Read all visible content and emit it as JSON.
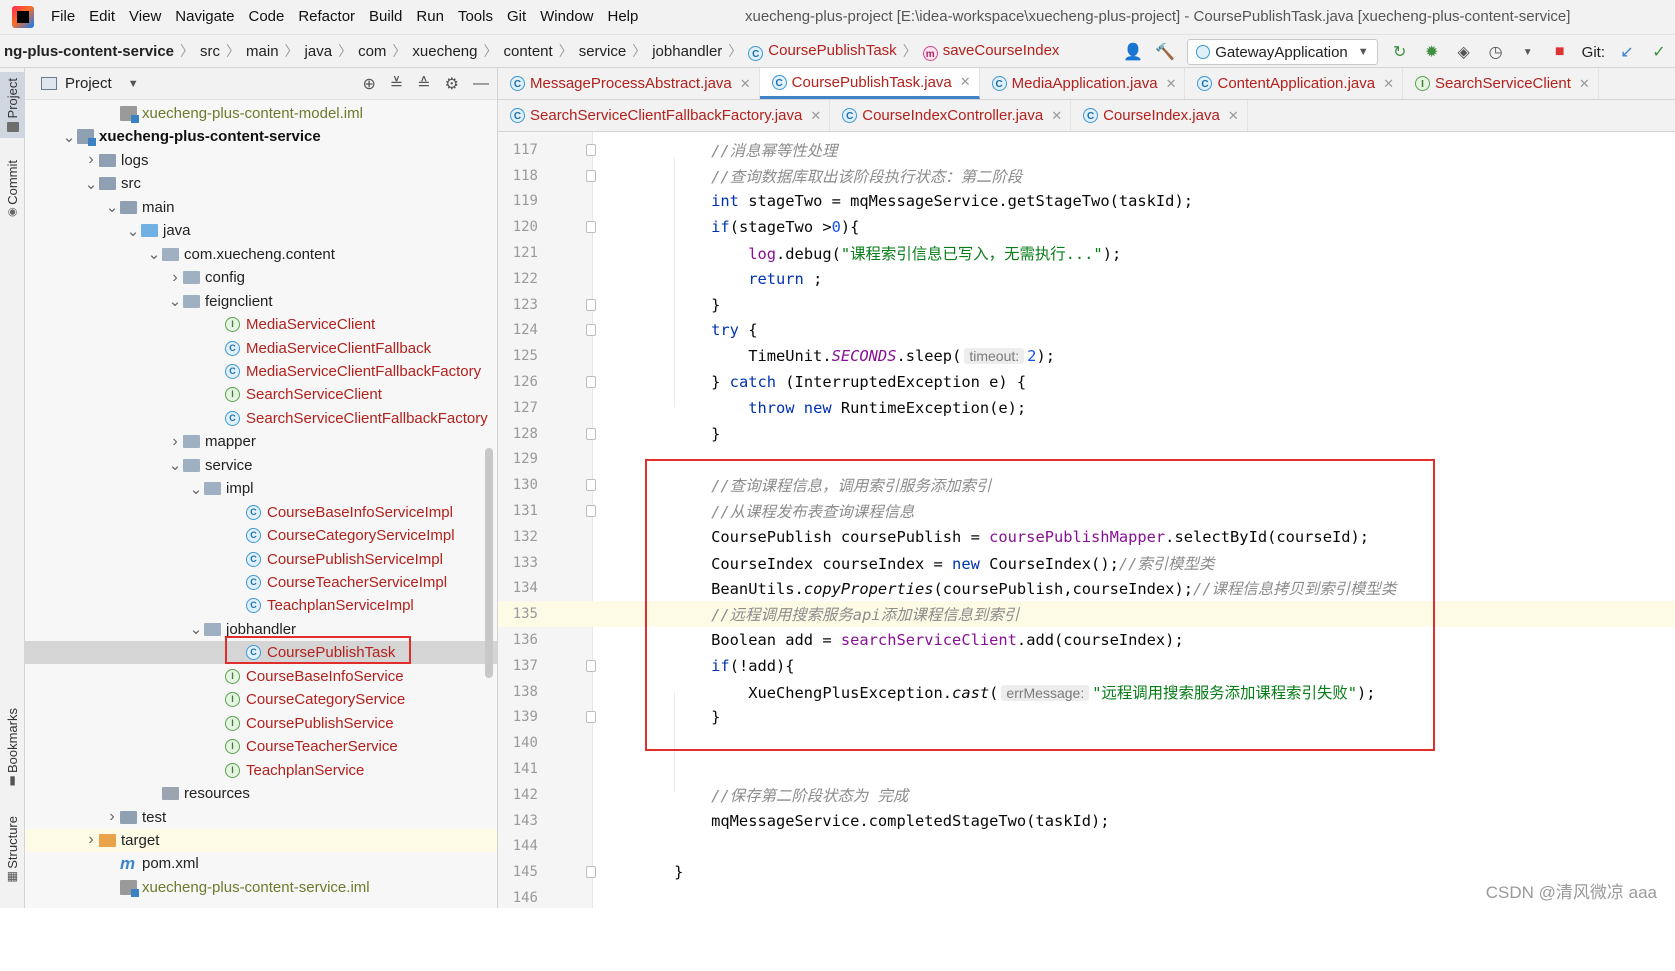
{
  "menu": [
    "File",
    "Edit",
    "View",
    "Navigate",
    "Code",
    "Refactor",
    "Build",
    "Run",
    "Tools",
    "Git",
    "Window",
    "Help"
  ],
  "window_title": "xuecheng-plus-project [E:\\idea-workspace\\xuecheng-plus-project] - CoursePublishTask.java [xuecheng-plus-content-service]",
  "breadcrumb": [
    "ng-plus-content-service",
    "src",
    "main",
    "java",
    "com",
    "xuecheng",
    "content",
    "service",
    "jobhandler",
    "CoursePublishTask",
    "saveCourseIndex"
  ],
  "toolbar": {
    "run_config": "GatewayApplication",
    "git_label": "Git:"
  },
  "left_strip": [
    "Project",
    "Commit",
    "Bookmarks",
    "Structure"
  ],
  "project_panel": {
    "title": "Project"
  },
  "tree": [
    {
      "label": "xuecheng-plus-content-model.iml",
      "kind": "iml",
      "style": "olive"
    },
    {
      "label": "xuecheng-plus-content-service",
      "kind": "module",
      "style": "bold"
    },
    {
      "label": "logs",
      "kind": "folder",
      "style": "dark"
    },
    {
      "label": "src",
      "kind": "folder",
      "style": "dark"
    },
    {
      "label": "main",
      "kind": "folder",
      "style": "dark"
    },
    {
      "label": "java",
      "kind": "folder-blue",
      "style": "dark"
    },
    {
      "label": "com.xuecheng.content",
      "kind": "package",
      "style": "dark"
    },
    {
      "label": "config",
      "kind": "package",
      "style": "dark"
    },
    {
      "label": "feignclient",
      "kind": "package",
      "style": "dark"
    },
    {
      "label": "MediaServiceClient",
      "kind": "interface",
      "style": "red"
    },
    {
      "label": "MediaServiceClientFallback",
      "kind": "class",
      "style": "red"
    },
    {
      "label": "MediaServiceClientFallbackFactory",
      "kind": "class",
      "style": "red"
    },
    {
      "label": "SearchServiceClient",
      "kind": "interface",
      "style": "red"
    },
    {
      "label": "SearchServiceClientFallbackFactory",
      "kind": "class",
      "style": "red"
    },
    {
      "label": "mapper",
      "kind": "package",
      "style": "dark"
    },
    {
      "label": "service",
      "kind": "package",
      "style": "dark"
    },
    {
      "label": "impl",
      "kind": "package",
      "style": "dark"
    },
    {
      "label": "CourseBaseInfoServiceImpl",
      "kind": "class",
      "style": "red"
    },
    {
      "label": "CourseCategoryServiceImpl",
      "kind": "class",
      "style": "red"
    },
    {
      "label": "CoursePublishServiceImpl",
      "kind": "class",
      "style": "red"
    },
    {
      "label": "CourseTeacherServiceImpl",
      "kind": "class",
      "style": "red"
    },
    {
      "label": "TeachplanServiceImpl",
      "kind": "class",
      "style": "red"
    },
    {
      "label": "jobhandler",
      "kind": "package",
      "style": "dark"
    },
    {
      "label": "CoursePublishTask",
      "kind": "class",
      "style": "red"
    },
    {
      "label": "CourseBaseInfoService",
      "kind": "interface",
      "style": "red"
    },
    {
      "label": "CourseCategoryService",
      "kind": "interface",
      "style": "red"
    },
    {
      "label": "CoursePublishService",
      "kind": "interface",
      "style": "red"
    },
    {
      "label": "CourseTeacherService",
      "kind": "interface",
      "style": "red"
    },
    {
      "label": "TeachplanService",
      "kind": "interface",
      "style": "red"
    },
    {
      "label": "resources",
      "kind": "folder-res",
      "style": "dark"
    },
    {
      "label": "test",
      "kind": "folder",
      "style": "dark"
    },
    {
      "label": "target",
      "kind": "folder-orange",
      "style": "dark"
    },
    {
      "label": "pom.xml",
      "kind": "maven",
      "style": "dark"
    },
    {
      "label": "xuecheng-plus-content-service.iml",
      "kind": "iml",
      "style": "olive"
    }
  ],
  "tabs_row1": [
    {
      "label": "MessageProcessAbstract.java",
      "icon": "class-icon"
    },
    {
      "label": "CoursePublishTask.java",
      "icon": "class-icon",
      "active": true
    },
    {
      "label": "MediaApplication.java",
      "icon": "class-icon"
    },
    {
      "label": "ContentApplication.java",
      "icon": "class-icon"
    },
    {
      "label": "SearchServiceClient",
      "icon": "interface-icon"
    }
  ],
  "tabs_row2": [
    {
      "label": "SearchServiceClientFallbackFactory.java",
      "icon": "class-icon"
    },
    {
      "label": "CourseIndexController.java",
      "icon": "class-icon"
    },
    {
      "label": "CourseIndex.java",
      "icon": "class-icon"
    }
  ],
  "code": {
    "line_numbers": [
      "117",
      "118",
      "119",
      "120",
      "121",
      "122",
      "123",
      "124",
      "125",
      "126",
      "127",
      "128",
      "129",
      "130",
      "131",
      "132",
      "133",
      "134",
      "135",
      "136",
      "137",
      "138",
      "139",
      "140",
      "141",
      "142",
      "143",
      "144",
      "145",
      "146"
    ],
    "current_line": "135",
    "hints": {
      "timeout": "timeout:",
      "err_message": "errMessage:"
    },
    "strings": {
      "log_msg": "\"课程索引信息已写入，无需执行...\"",
      "fail_msg": "\"远程调用搜索服务添加课程索引失败\""
    },
    "comments": {
      "c117": "//消息幂等性处理",
      "c118": "//查询数据库取出该阶段执行状态：第二阶段",
      "c130": "//查询课程信息，调用索引服务添加索引",
      "c131": "//从课程发布表查询课程信息",
      "c133": "//索引模型类",
      "c134": "//课程信息拷贝到索引模型类",
      "c135": "//远程调用搜索服务api添加课程信息到索引",
      "c142": "//保存第二阶段状态为 完成"
    }
  },
  "watermark": "CSDN @清风微凉 aaa"
}
